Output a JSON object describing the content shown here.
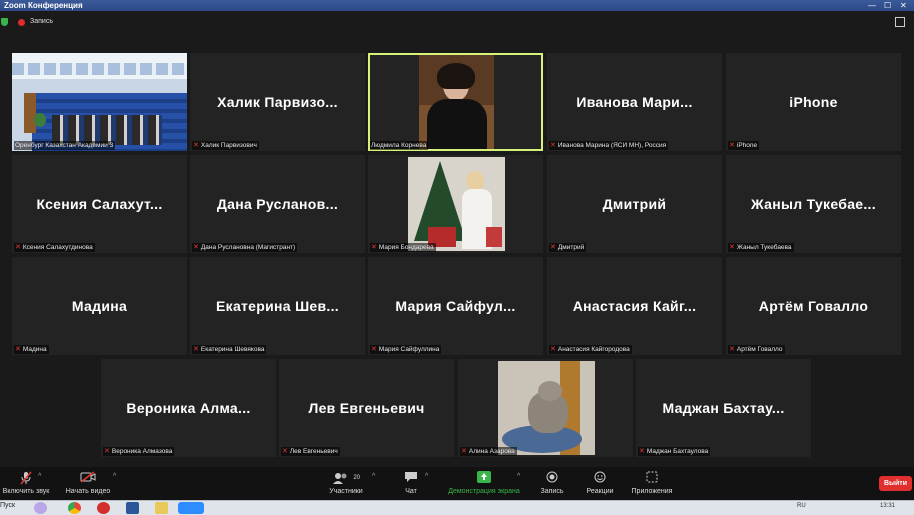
{
  "window": {
    "title": "Zoom Конференция",
    "controls": [
      "—",
      "☐",
      "✕"
    ]
  },
  "topbar": {
    "recording_label": "Запись",
    "security_icon": "shield-icon",
    "view_icon": "grid-view-icon"
  },
  "tiles": [
    {
      "id": "t1",
      "type": "video",
      "scene": "conference-hall",
      "display_name": "",
      "label": "Оренбург Казахстан Академии 3",
      "muted": false
    },
    {
      "id": "t2",
      "type": "name",
      "display_name": "Халик Парвизо...",
      "label": "Халик Парвизович",
      "muted": true
    },
    {
      "id": "t3",
      "type": "video",
      "scene": "person",
      "display_name": "",
      "label": "Людмила Корнева",
      "muted": false,
      "active_speaker": true
    },
    {
      "id": "t4",
      "type": "name",
      "display_name": "Иванова Мари...",
      "label": "Иванова Марина (ЯСИ МН), Россия",
      "muted": true
    },
    {
      "id": "t5",
      "type": "name",
      "display_name": "iPhone",
      "label": "iPhone",
      "muted": true
    },
    {
      "id": "t6",
      "type": "name",
      "display_name": "Ксения Салахут...",
      "label": "Ксения Салахутдинова",
      "muted": true
    },
    {
      "id": "t7",
      "type": "name",
      "display_name": "Дана Русланов...",
      "label": "Дана Руслановна (Магистрант)",
      "muted": true
    },
    {
      "id": "t8",
      "type": "video",
      "scene": "christmas-tree",
      "display_name": "",
      "label": "Мария Бондарева",
      "muted": true
    },
    {
      "id": "t9",
      "type": "name",
      "display_name": "Дмитрий",
      "label": "Дмитрий",
      "muted": true
    },
    {
      "id": "t10",
      "type": "name",
      "display_name": "Жаныл Тукебае...",
      "label": "Жаныл Тукебаева",
      "muted": true
    },
    {
      "id": "t11",
      "type": "name",
      "display_name": "Мадина",
      "label": "Мадина",
      "muted": true
    },
    {
      "id": "t12",
      "type": "name",
      "display_name": "Екатерина Шев...",
      "label": "Екатерина Шевякова",
      "muted": true
    },
    {
      "id": "t13",
      "type": "name",
      "display_name": "Мария Сайфул...",
      "label": "Мария Сайфуллина",
      "muted": true
    },
    {
      "id": "t14",
      "type": "name",
      "display_name": "Анастасия Кайг...",
      "label": "Анастасия Кайгородова",
      "muted": true
    },
    {
      "id": "t15",
      "type": "name",
      "display_name": "Артём Говалло",
      "label": "Артём Говалло",
      "muted": true
    },
    {
      "id": "t16",
      "type": "name",
      "display_name": "Вероника Алма...",
      "label": "Вероника Алмазова",
      "muted": true
    },
    {
      "id": "t17",
      "type": "name",
      "display_name": "Лев Евгеньевич",
      "label": "Лев Евгеньевич",
      "muted": true
    },
    {
      "id": "t18",
      "type": "video",
      "scene": "cat",
      "display_name": "",
      "label": "Алина Азарова",
      "muted": true
    },
    {
      "id": "t19",
      "type": "name",
      "display_name": "Маджан Бахтау...",
      "label": "Маджан Бахтаулова",
      "muted": true
    }
  ],
  "toolbar": {
    "items": [
      {
        "id": "unmute",
        "label": "Включить звук",
        "icon": "mic-muted-icon",
        "caret": true
      },
      {
        "id": "video",
        "label": "Начать видео",
        "icon": "video-off-icon",
        "caret": true
      },
      {
        "id": "participants",
        "label": "Участники",
        "icon": "participants-icon",
        "badge": "20",
        "caret": true
      },
      {
        "id": "chat",
        "label": "Чат",
        "icon": "chat-icon",
        "caret": true
      },
      {
        "id": "share",
        "label": "Демонстрация экрана",
        "icon": "share-screen-icon",
        "caret": true,
        "color": "#39b54a"
      },
      {
        "id": "record",
        "label": "Запись",
        "icon": "record-icon",
        "caret": false
      },
      {
        "id": "reactions",
        "label": "Реакции",
        "icon": "reactions-icon",
        "caret": false
      },
      {
        "id": "apps",
        "label": "Приложения",
        "icon": "apps-icon",
        "caret": false
      }
    ],
    "leave_label": "Выйти",
    "leave_color": "#e02f2f"
  },
  "taskbar": {
    "start_label": "Пуск",
    "tray_lang": "RU",
    "clock": "13:31"
  }
}
